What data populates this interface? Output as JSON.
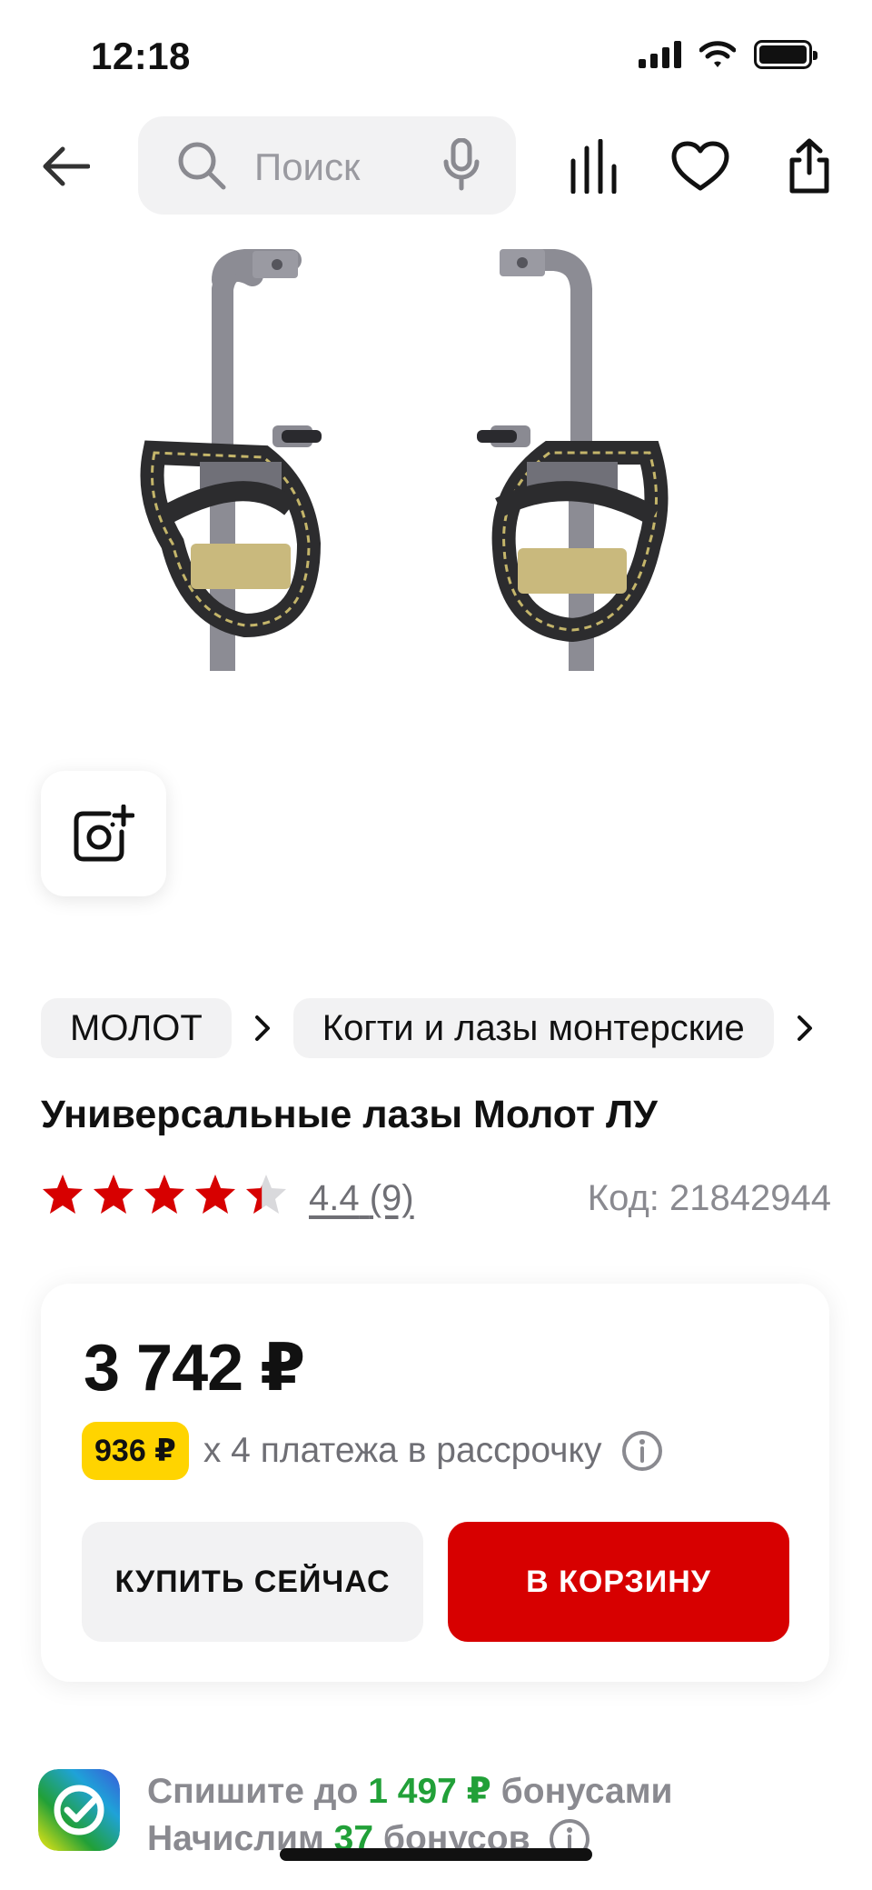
{
  "status_bar": {
    "time": "12:18"
  },
  "search": {
    "placeholder": "Поиск"
  },
  "breadcrumbs": [
    "МОЛОТ",
    "Когти и лазы монтерские"
  ],
  "product": {
    "title": "Универсальные лазы Молот ЛУ",
    "rating": {
      "value": "4.4",
      "count": "(9)",
      "stars": 4.4
    },
    "sku": "Код: 21842944"
  },
  "price_card": {
    "price": "3 742 ₽",
    "installment_amount": "936 ₽",
    "installment_text": "x 4 платежа в рассрочку",
    "buy_now_label": "КУПИТЬ СЕЙЧАС",
    "to_cart_label": "В КОРЗИНУ"
  },
  "bonus": {
    "line1_prefix": "Спишите до",
    "line1_amount": "1 497 ₽",
    "line1_suffix": "бонусами",
    "line2_prefix": "Начислим",
    "line2_amount": "37",
    "line2_suffix": "бонусов"
  },
  "colors": {
    "accent_red": "#d70000",
    "installment_yellow": "#ffd400",
    "bonus_green": "#21a038",
    "star_red": "#d70000"
  },
  "icons": {
    "back": "arrow-left-icon",
    "search": "search-icon",
    "mic": "mic-icon",
    "compare": "compare-icon",
    "favorite": "heart-icon",
    "share": "share-icon",
    "photo_search": "camera-plus-icon",
    "breadcrumb_separator": "chevron-right-icon",
    "info": "info-icon",
    "bonus_logo": "sber-logo-icon"
  }
}
